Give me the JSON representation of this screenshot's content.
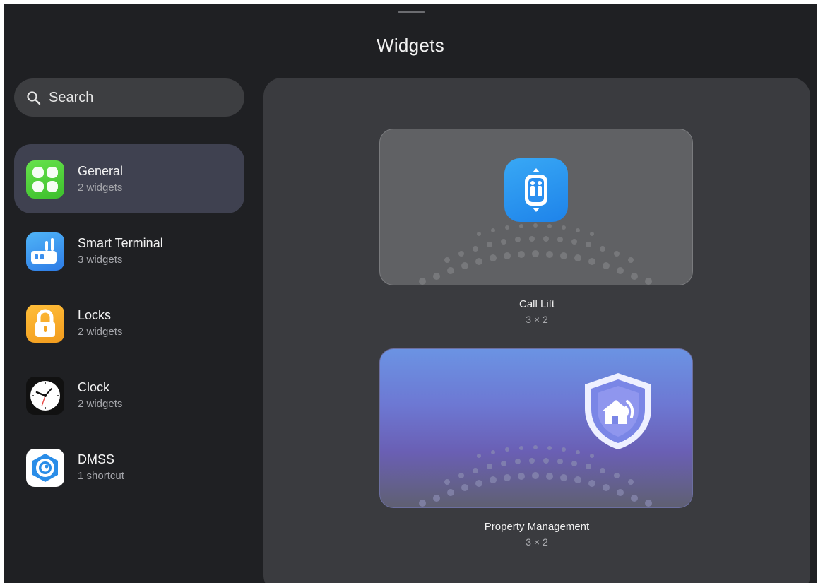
{
  "header": {
    "title": "Widgets"
  },
  "search": {
    "placeholder": "Search"
  },
  "categories": [
    {
      "name": "General",
      "count": "2 widgets",
      "icon": "general-grid-icon",
      "selected": true
    },
    {
      "name": "Smart Terminal",
      "count": "3 widgets",
      "icon": "smart-terminal-icon"
    },
    {
      "name": "Locks",
      "count": "2 widgets",
      "icon": "lock-icon"
    },
    {
      "name": "Clock",
      "count": "2 widgets",
      "icon": "clock-icon"
    },
    {
      "name": "DMSS",
      "count": "1 shortcut",
      "icon": "dmss-icon"
    }
  ],
  "widgets": [
    {
      "name": "Call Lift",
      "size": "3 × 2",
      "icon": "elevator-icon"
    },
    {
      "name": "Property Management",
      "size": "3 × 2",
      "icon": "shield-house-phone-icon"
    }
  ],
  "colors": {
    "background": "#1f2023",
    "panel": "#3a3b3f",
    "selected_item": "#3f4150",
    "accent_blue": "#2196f3",
    "accent_green": "#55d13b",
    "accent_orange": "#f5a623"
  }
}
